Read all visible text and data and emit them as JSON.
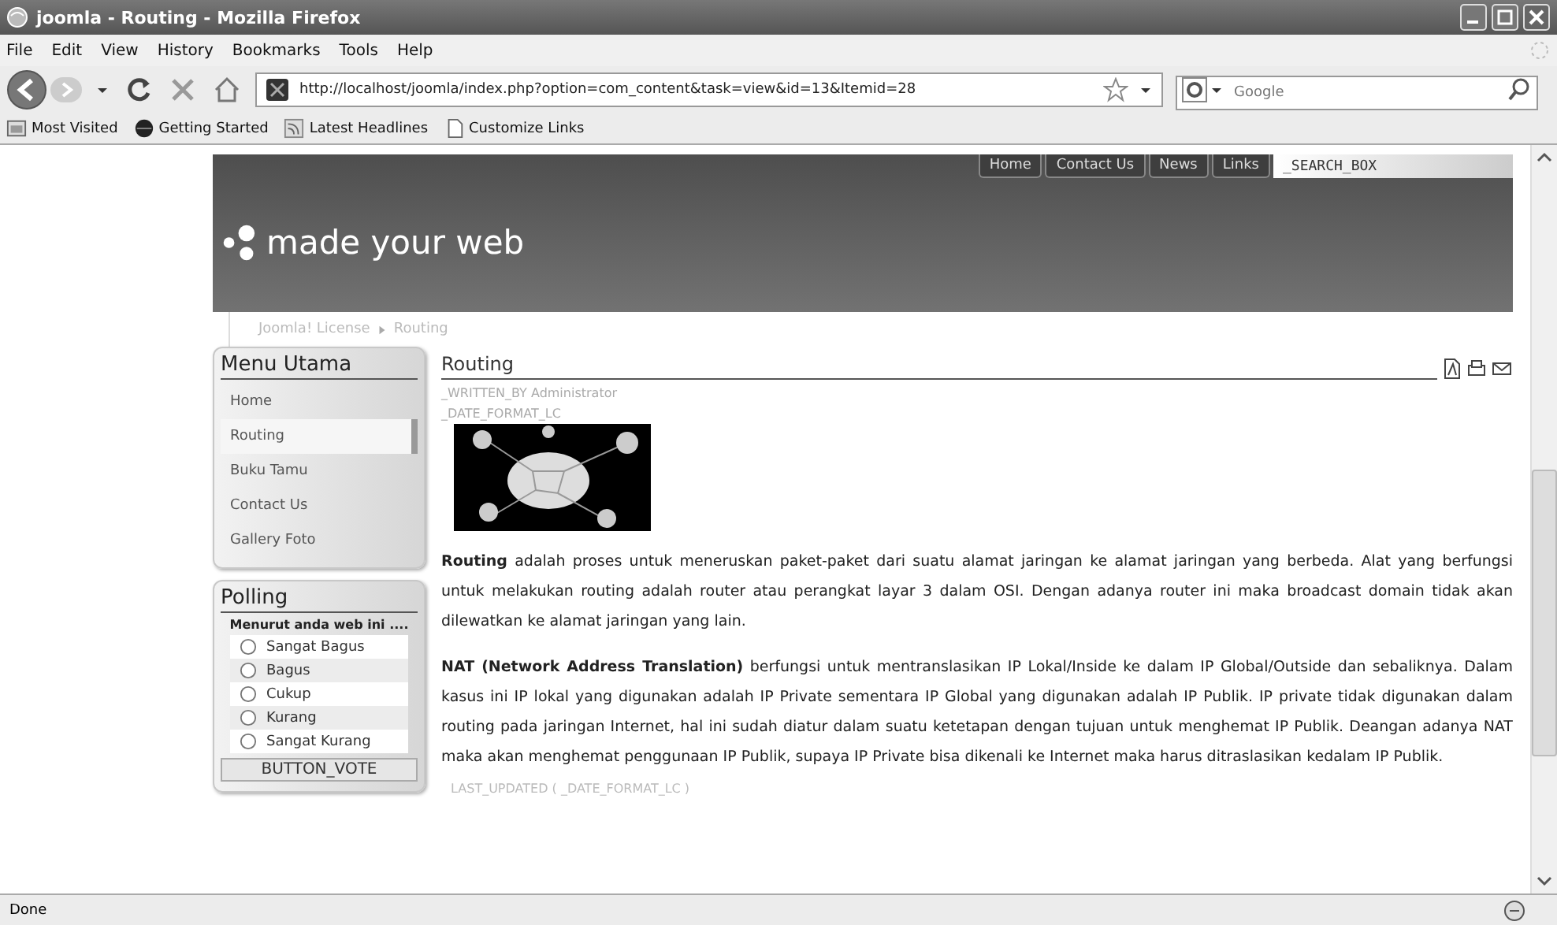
{
  "window": {
    "title": "joomla - Routing - Mozilla Firefox"
  },
  "menu_bar": [
    "File",
    "Edit",
    "View",
    "History",
    "Bookmarks",
    "Tools",
    "Help"
  ],
  "address_bar": {
    "url": "http://localhost/joomla/index.php?option=com_content&task=view&id=13&Itemid=28"
  },
  "search_field": {
    "placeholder": "Google"
  },
  "bookmarks": [
    {
      "label": "Most Visited",
      "kind": "folder"
    },
    {
      "label": "Getting Started",
      "kind": "globe"
    },
    {
      "label": "Latest Headlines",
      "kind": "feed"
    },
    {
      "label": "Customize Links",
      "kind": "page"
    }
  ],
  "site": {
    "top_nav": [
      "Home",
      "Contact Us",
      "News",
      "Links"
    ],
    "search_box": {
      "value": "_SEARCH_BOX"
    },
    "logo": "made your web",
    "breadcrumb": [
      "Joomla! License",
      "Routing"
    ],
    "main_menu": {
      "title": "Menu Utama",
      "items": [
        {
          "label": "Home",
          "selected": false
        },
        {
          "label": "Routing",
          "selected": true
        },
        {
          "label": "Buku Tamu",
          "selected": false
        },
        {
          "label": "Contact Us",
          "selected": false
        },
        {
          "label": "Gallery Foto",
          "selected": false
        }
      ]
    },
    "poll": {
      "title": "Polling",
      "question": "Menurut anda web ini ....",
      "options": [
        {
          "label": "Sangat Bagus",
          "selected": false
        },
        {
          "label": "Bagus",
          "selected": false
        },
        {
          "label": "Cukup",
          "selected": false
        },
        {
          "label": "Kurang",
          "selected": false
        },
        {
          "label": "Sangat Kurang",
          "selected": false
        }
      ],
      "button": "BUTTON_VOTE"
    },
    "article": {
      "title": "Routing",
      "author": "_WRITTEN_BY Administrator",
      "date": "_DATE_FORMAT_LC",
      "paragraphs": [
        "**Routing** adalah proses untuk meneruskan paket-paket dari suatu alamat jaringan ke  alamat jaringan yang berbeda. Alat yang berfungsi untuk melakukan routing adalah router atau perangkat layar 3 dalam OSI. Dengan adanya router ini maka broadcast domain tidak akan dilewatkan ke alamat jaringan yang lain.",
        "**NAT (Network Address Translation)** berfungsi untuk mentranslasikan IP Lokal/Inside ke dalam IP Global/Outside dan sebaliknya. Dalam kasus ini IP lokal yang digunakan adalah IP Private sementara IP Global yang digunakan adalah IP Publik. IP private tidak digunakan dalam routing pada jaringan Internet, hal ini sudah diatur dalam suatu ketetapan dengan tujuan untuk menghemat IP Publik. Deangan adanya NAT maka akan menghemat penggunaan IP Publik, supaya IP Private bisa dikenali ke Internet maka harus ditraslasikan kedalam IP Publik."
      ],
      "last_updated": "LAST_UPDATED ( _DATE_FORMAT_LC )"
    }
  },
  "status_bar": {
    "text": "Done"
  }
}
